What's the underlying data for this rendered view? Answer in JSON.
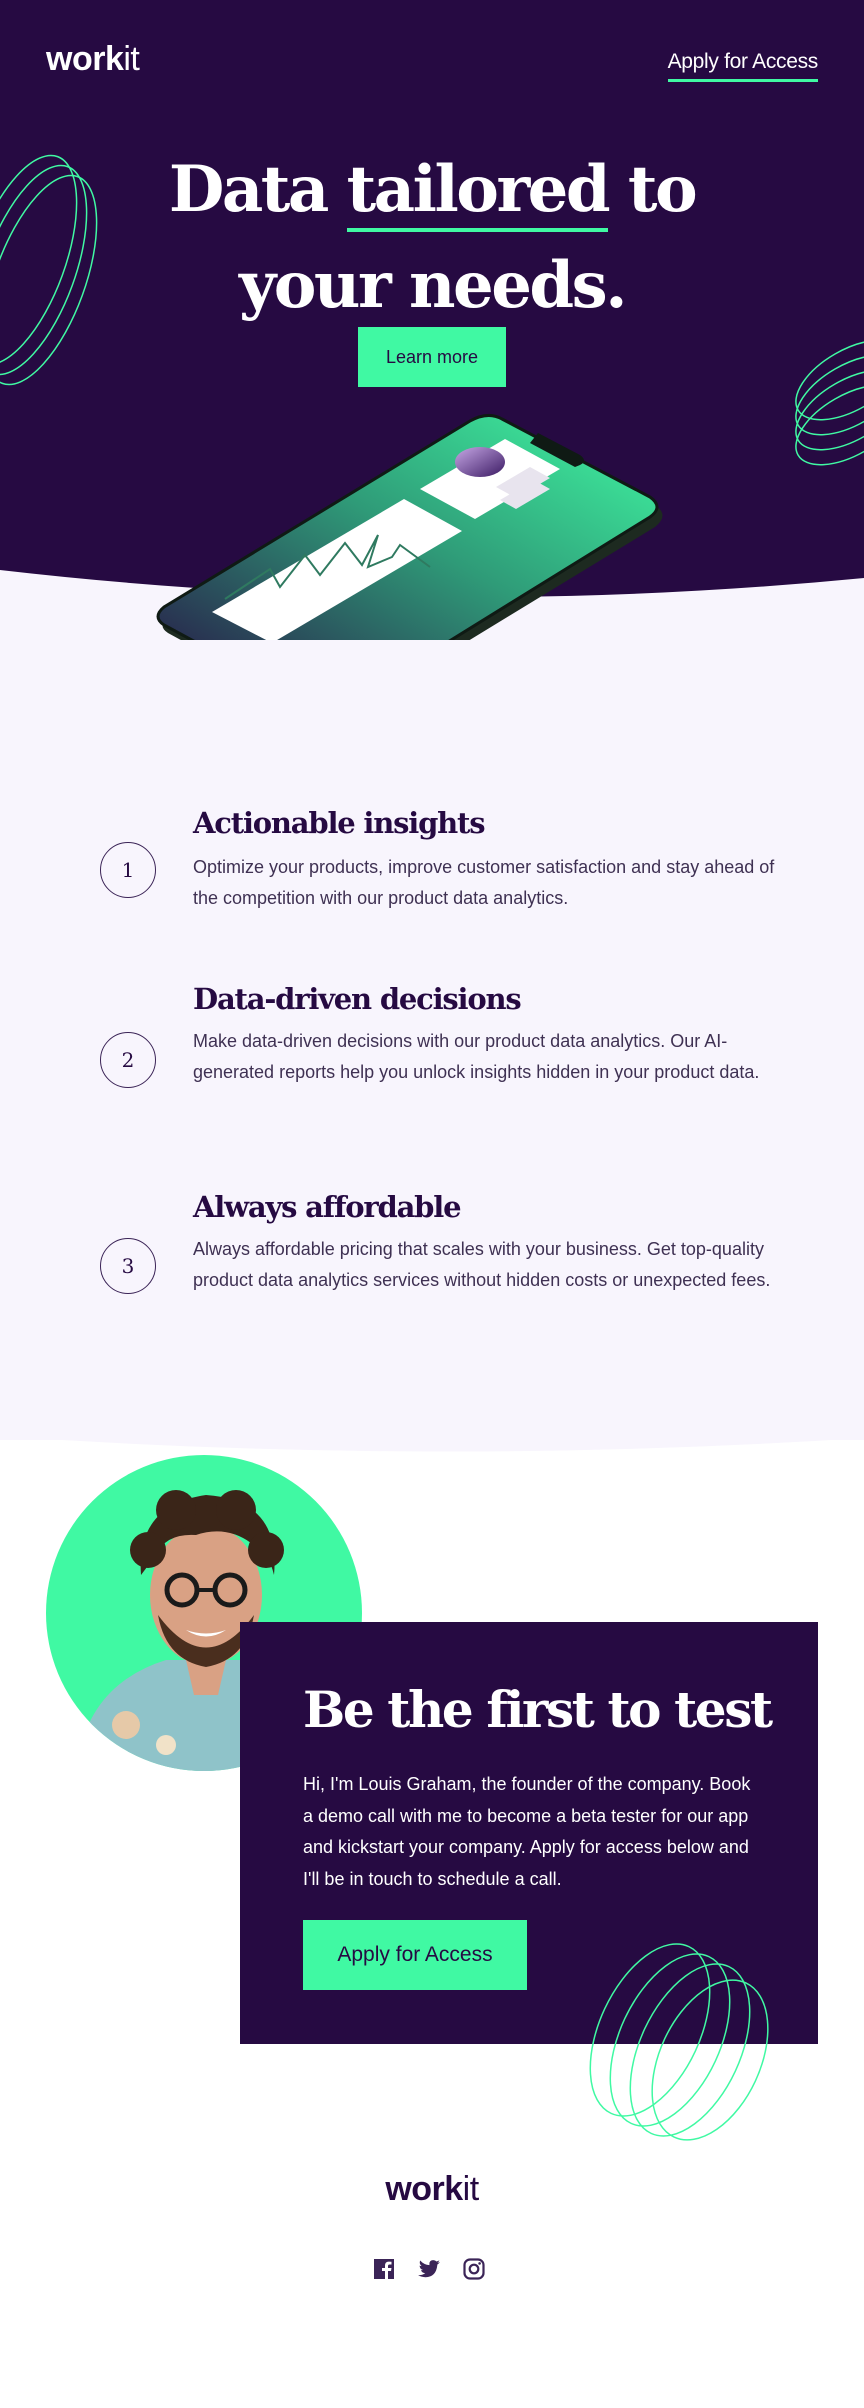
{
  "header": {
    "logo_bold": "work",
    "logo_light": "it",
    "nav_cta": "Apply for Access"
  },
  "hero": {
    "title_part1": "Data ",
    "title_underlined": "tailored",
    "title_part2": " to",
    "title_line2": "your needs.",
    "button_label": "Learn more"
  },
  "features": [
    {
      "number": "1",
      "title": "Actionable insights",
      "text": "Optimize your products, improve customer satisfaction and stay ahead of the competition with our product data analytics."
    },
    {
      "number": "2",
      "title": "Data-driven decisions",
      "text": "Make data-driven decisions with our product data analytics. Our AI-generated reports help you unlock insights hidden in your product data."
    },
    {
      "number": "3",
      "title": "Always affordable",
      "text": "Always affordable pricing that scales with your business. Get top-quality product data analytics services without hidden costs or unexpected fees."
    }
  ],
  "cta": {
    "title": "Be the first to test",
    "text": "Hi, I'm Louis Graham, the founder of the company. Book a demo call with me to become a beta tester for our app and kickstart your company. Apply for access below and I'll be in touch to schedule a call.",
    "button_label": "Apply for Access"
  },
  "footer": {
    "logo_bold": "work",
    "logo_light": "it",
    "socials": [
      "facebook-icon",
      "twitter-icon",
      "instagram-icon"
    ]
  },
  "colors": {
    "primary": "#260a42",
    "accent": "#40f9a3",
    "light_bg": "#f8f5fd"
  }
}
